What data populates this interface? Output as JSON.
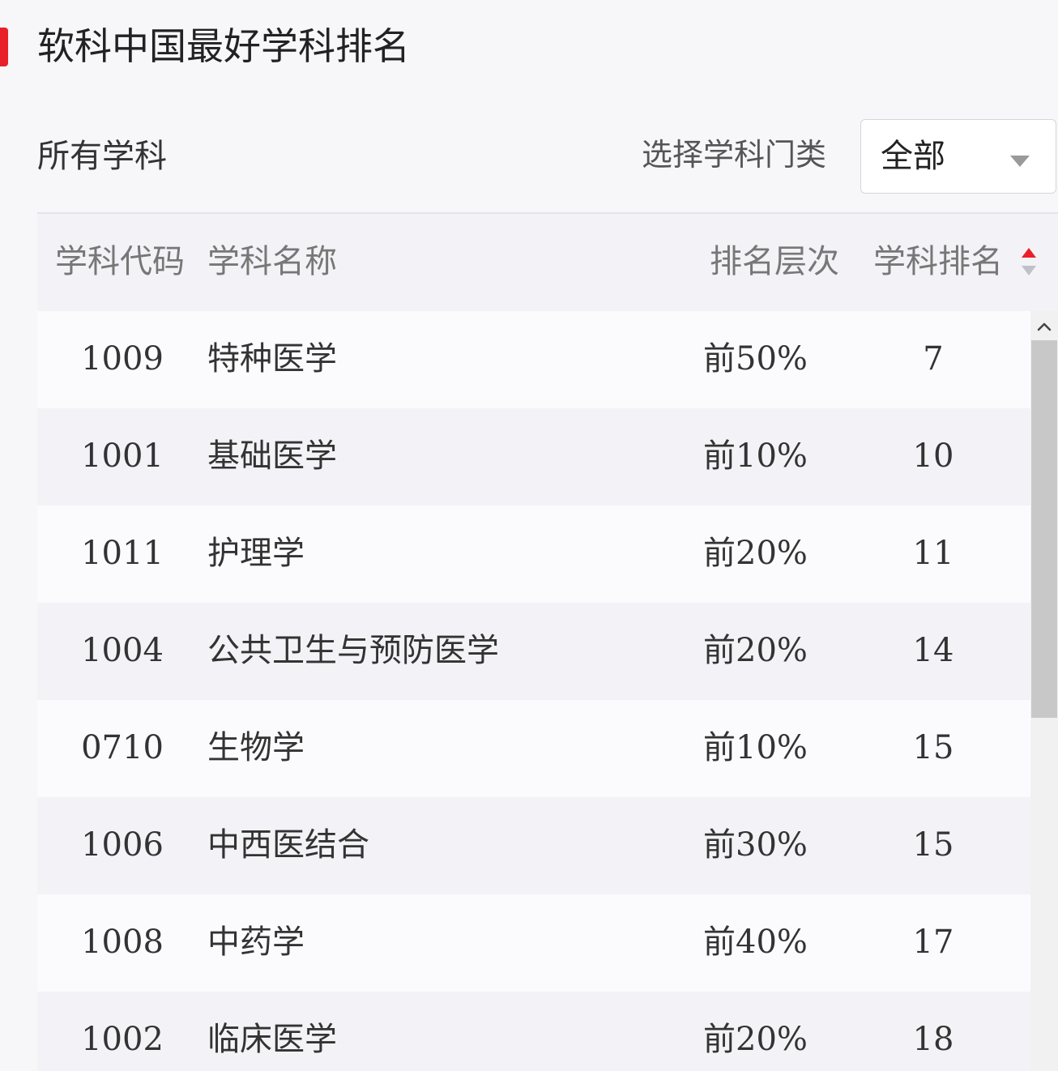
{
  "header": {
    "title": "软科中国最好学科排名",
    "accent_color": "#e8202a"
  },
  "toolbar": {
    "subtitle": "所有学科",
    "filter_label": "选择学科门类",
    "filter_selected": "全部"
  },
  "table": {
    "columns": {
      "code": "学科代码",
      "name": "学科名称",
      "level": "排名层次",
      "rank": "学科排名"
    },
    "sort": {
      "column": "rank",
      "direction": "ascending"
    },
    "rows": [
      {
        "code": "1009",
        "name": "特种医学",
        "level": "前50%",
        "rank": "7"
      },
      {
        "code": "1001",
        "name": "基础医学",
        "level": "前10%",
        "rank": "10"
      },
      {
        "code": "1011",
        "name": "护理学",
        "level": "前20%",
        "rank": "11"
      },
      {
        "code": "1004",
        "name": "公共卫生与预防医学",
        "level": "前20%",
        "rank": "14"
      },
      {
        "code": "0710",
        "name": "生物学",
        "level": "前10%",
        "rank": "15"
      },
      {
        "code": "1006",
        "name": "中西医结合",
        "level": "前30%",
        "rank": "15"
      },
      {
        "code": "1008",
        "name": "中药学",
        "level": "前40%",
        "rank": "17"
      },
      {
        "code": "1002",
        "name": "临床医学",
        "level": "前20%",
        "rank": "18"
      }
    ]
  }
}
